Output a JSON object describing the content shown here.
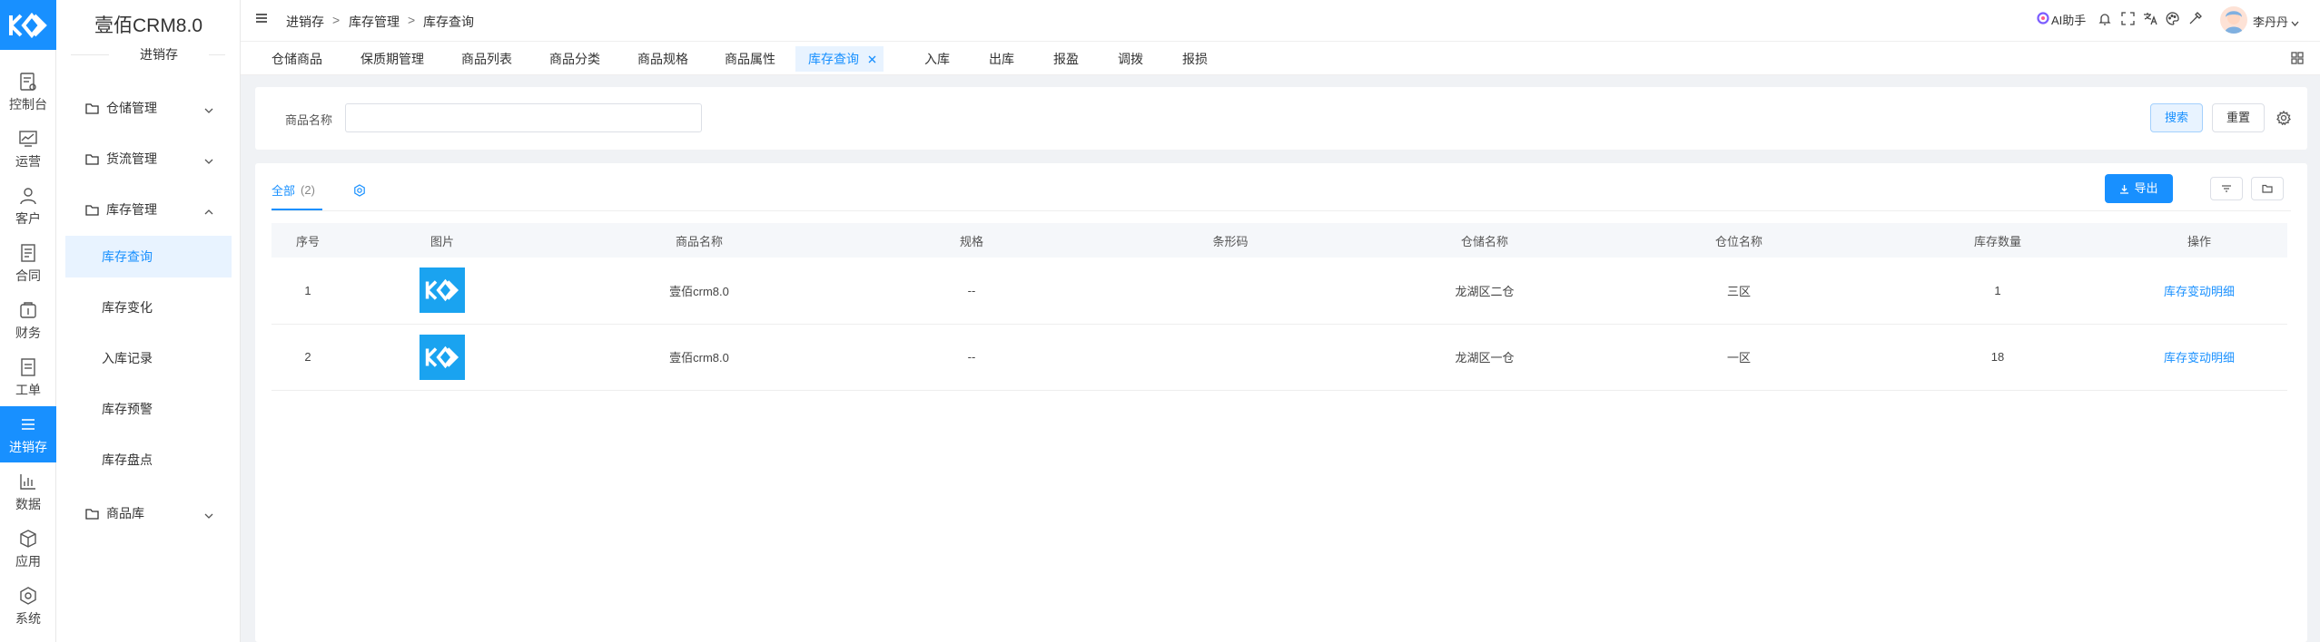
{
  "rail": {
    "items": [
      {
        "label": "控制台",
        "icon": "dashboard-icon"
      },
      {
        "label": "运营",
        "icon": "chart-line-icon"
      },
      {
        "label": "客户",
        "icon": "customer-icon"
      },
      {
        "label": "合同",
        "icon": "contract-icon"
      },
      {
        "label": "财务",
        "icon": "finance-icon"
      },
      {
        "label": "工单",
        "icon": "ticket-icon"
      },
      {
        "label": "进销存",
        "icon": "list-icon",
        "active": true
      },
      {
        "label": "数据",
        "icon": "data-chart-icon"
      },
      {
        "label": "应用",
        "icon": "cube-icon"
      },
      {
        "label": "系统",
        "icon": "system-icon"
      }
    ]
  },
  "sidebar": {
    "brand": "壹佰CRM8.0",
    "module": "进销存",
    "groups": [
      {
        "label": "仓储管理"
      },
      {
        "label": "货流管理"
      },
      {
        "label": "库存管理"
      },
      {
        "label": "商品库"
      }
    ],
    "items": [
      {
        "label": "库存查询"
      },
      {
        "label": "库存变化"
      },
      {
        "label": "入库记录"
      },
      {
        "label": "库存预警"
      },
      {
        "label": "库存盘点"
      }
    ]
  },
  "topbar": {
    "breadcrumb": [
      "进销存",
      "库存管理",
      "库存查询"
    ],
    "separator": ">",
    "ai_label": "AI助手",
    "user_name": "李丹丹"
  },
  "tabs": [
    "仓储商品",
    "保质期管理",
    "商品列表",
    "商品分类",
    "商品规格",
    "商品属性",
    "库存查询",
    "入库",
    "出库",
    "报盈",
    "调拨",
    "报损"
  ],
  "filter": {
    "label": "商品名称",
    "value": "",
    "search_label": "搜索",
    "reset_label": "重置"
  },
  "main": {
    "tab_label": "全部",
    "tab_count": "(2)",
    "export_label": "导出",
    "columns": [
      "序号",
      "图片",
      "商品名称",
      "规格",
      "条形码",
      "仓储名称",
      "仓位名称",
      "库存数量",
      "操作"
    ],
    "rows": [
      {
        "no": "1",
        "name": "壹佰crm8.0",
        "spec": "--",
        "barcode": "",
        "warehouse": "龙湖区二仓",
        "location": "三区",
        "qty": "1",
        "action": "库存变动明细"
      },
      {
        "no": "2",
        "name": "壹佰crm8.0",
        "spec": "--",
        "barcode": "",
        "warehouse": "龙湖区一仓",
        "location": "一区",
        "qty": "18",
        "action": "库存变动明细"
      }
    ]
  },
  "colors": {
    "primary": "#1890ff",
    "thumb": "#1aa3f0"
  }
}
